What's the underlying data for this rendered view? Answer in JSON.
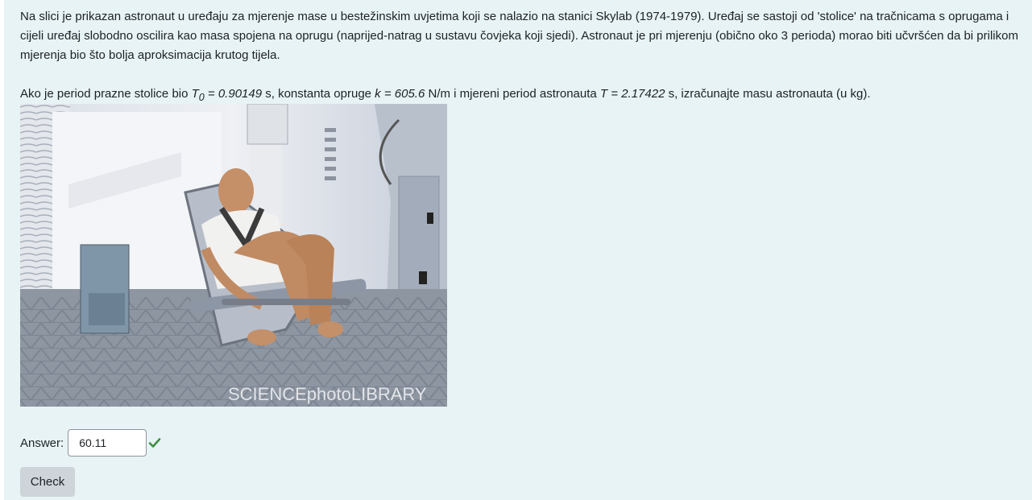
{
  "question": {
    "paragraph1": "Na slici je prikazan astronaut u uređaju za mjerenje mase u bestežinskim uvjetima koji se nalazio na stanici Skylab (1974-1979). Uređaj se sastoji od 'stolice' na tračnicama s oprugama i cijeli uređaj slobodno oscilira kao masa spojena na oprugu (naprijed-natrag u sustavu čovjeka koji sjedi). Astronaut je pri mjerenju (obično oko 3 perioda) morao biti učvršćen da bi prilikom mjerenja bio što bolja aproksimacija krutog tijela.",
    "p2_intro": "Ako je period prazne stolice bio ",
    "t0_symbol": "T",
    "t0_sub": "0",
    "t0_value": " = 0.90149",
    "p2_mid1": " s, konstanta opruge ",
    "k_symbol": "k",
    "k_value": " = 605.6",
    "p2_mid2": " N/m i mjereni period astronauta ",
    "t_symbol": "T",
    "t_value": " = 2.17422",
    "p2_end": " s, izračunajte masu astronauta (u kg).",
    "image_watermark": "SCIENCEphotoLIBRARY"
  },
  "answer": {
    "label": "Answer:",
    "value": "60.11",
    "status": "correct",
    "status_color": "#3e8e41"
  },
  "check_button": {
    "label": "Check"
  }
}
